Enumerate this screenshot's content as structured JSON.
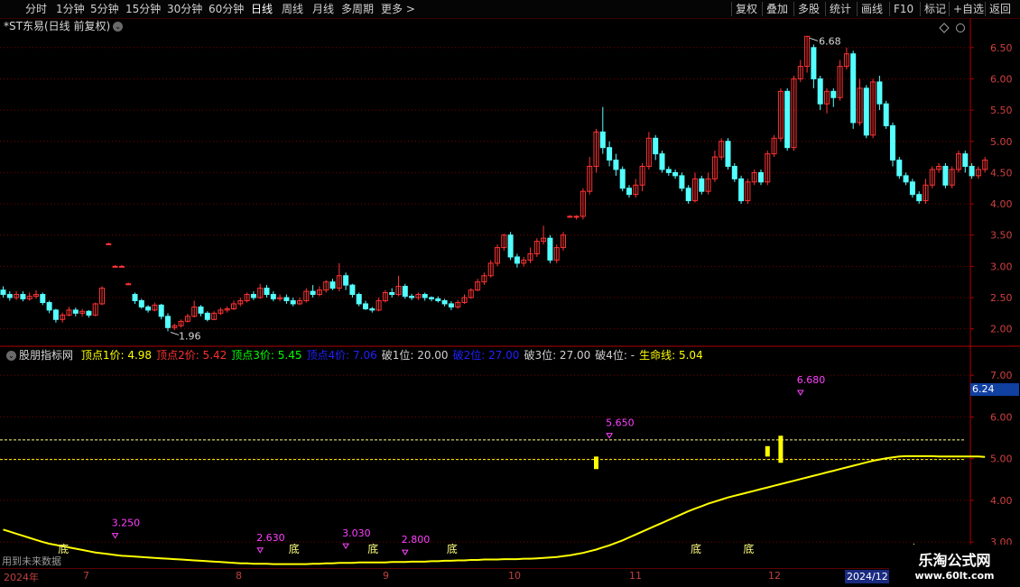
{
  "toolbar": {
    "left": [
      "分时",
      "1分钟",
      "5分钟",
      "15分钟",
      "30分钟",
      "60分钟",
      "日线",
      "周线",
      "月线",
      "多周期",
      "更多 >"
    ],
    "active_index": 6,
    "right": [
      "复权",
      "叠加",
      "多股",
      "统计",
      "画线",
      "F10",
      "标记",
      "+自选",
      "返回"
    ]
  },
  "main_header": {
    "title": "*ST东易(日线 前复权)"
  },
  "indicator_header": {
    "name": "股朋指标网",
    "items": [
      {
        "text": "顶点1价: 4.98",
        "color": "#ffff00"
      },
      {
        "text": "顶点2价: 5.42",
        "color": "#ff3030"
      },
      {
        "text": "顶点3价: 5.45",
        "color": "#00ff00"
      },
      {
        "text": "顶点4价: 7.06",
        "color": "#2020ff"
      },
      {
        "text": "破1位: 20.00",
        "color": "#d0d0d0"
      },
      {
        "text": "破2位: 27.00",
        "color": "#2020ff"
      },
      {
        "text": "破3位: 27.00",
        "color": "#d0d0d0"
      },
      {
        "text": "破4位: -",
        "color": "#d0d0d0"
      },
      {
        "text": "生命线: 5.04",
        "color": "#ffff00"
      }
    ]
  },
  "hint": "用到未来数据",
  "price_tag": "6.24",
  "watermark": {
    "title": "乐淘公式网",
    "url": "www.60lt.com"
  },
  "dates": [
    {
      "label": "2024年"
    },
    {
      "label": "7"
    },
    {
      "label": "8"
    },
    {
      "label": "9"
    },
    {
      "label": "10"
    },
    {
      "label": "11"
    },
    {
      "label": "12"
    },
    {
      "label": "2024/12"
    }
  ],
  "colors": {
    "up": "#ff3333",
    "down": "#54ffff",
    "grid": "#7a0000",
    "axis": "#b00000",
    "life": "#ffff00",
    "top": "#ff40ff",
    "bottom": "#ffff80"
  },
  "chart_data": [
    {
      "type": "candlestick",
      "ylim": [
        1.75,
        6.8
      ],
      "y_ticks": [
        "6.50",
        "6.00",
        "5.50",
        "5.00",
        "4.50",
        "4.00",
        "3.50",
        "3.00",
        "2.50",
        "2.00"
      ],
      "annotations": [
        {
          "text": "6.68",
          "kind": "high"
        },
        {
          "text": "1.96",
          "kind": "low"
        }
      ],
      "candles": [
        [
          2.62,
          2.55,
          2.68,
          2.5
        ],
        [
          2.55,
          2.5,
          2.6,
          2.45
        ],
        [
          2.5,
          2.55,
          2.6,
          2.46
        ],
        [
          2.55,
          2.48,
          2.6,
          2.44
        ],
        [
          2.48,
          2.52,
          2.58,
          2.45
        ],
        [
          2.52,
          2.55,
          2.62,
          2.48
        ],
        [
          2.55,
          2.42,
          2.58,
          2.38
        ],
        [
          2.42,
          2.3,
          2.45,
          2.25
        ],
        [
          2.3,
          2.15,
          2.32,
          2.1
        ],
        [
          2.15,
          2.22,
          2.26,
          2.1
        ],
        [
          2.22,
          2.3,
          2.35,
          2.2
        ],
        [
          2.3,
          2.25,
          2.34,
          2.2
        ],
        [
          2.25,
          2.28,
          2.32,
          2.2
        ],
        [
          2.28,
          2.22,
          2.3,
          2.18
        ],
        [
          2.22,
          2.4,
          2.42,
          2.2
        ],
        [
          2.4,
          2.65,
          2.68,
          2.38
        ],
        [
          3.35,
          3.36,
          3.38,
          3.34
        ],
        [
          3.0,
          3.0,
          3.02,
          2.98
        ],
        [
          3.0,
          3.0,
          3.02,
          2.98
        ],
        [
          2.72,
          2.72,
          2.74,
          2.7
        ],
        [
          2.55,
          2.45,
          2.58,
          2.4
        ],
        [
          2.45,
          2.35,
          2.48,
          2.32
        ],
        [
          2.35,
          2.3,
          2.38,
          2.26
        ],
        [
          2.3,
          2.38,
          2.42,
          2.28
        ],
        [
          2.38,
          2.2,
          2.4,
          2.15
        ],
        [
          2.2,
          2.02,
          2.25,
          1.96
        ],
        [
          2.02,
          2.05,
          2.08,
          1.98
        ],
        [
          2.05,
          2.12,
          2.15,
          2.02
        ],
        [
          2.12,
          2.2,
          2.24,
          2.1
        ],
        [
          2.2,
          2.35,
          2.45,
          2.18
        ],
        [
          2.35,
          2.25,
          2.38,
          2.2
        ],
        [
          2.25,
          2.15,
          2.28,
          2.12
        ],
        [
          2.15,
          2.25,
          2.28,
          2.14
        ],
        [
          2.25,
          2.3,
          2.34,
          2.22
        ],
        [
          2.3,
          2.32,
          2.36,
          2.26
        ],
        [
          2.32,
          2.4,
          2.45,
          2.3
        ],
        [
          2.4,
          2.45,
          2.5,
          2.36
        ],
        [
          2.45,
          2.55,
          2.58,
          2.42
        ],
        [
          2.55,
          2.5,
          2.6,
          2.46
        ],
        [
          2.5,
          2.65,
          2.72,
          2.48
        ],
        [
          2.65,
          2.55,
          2.7,
          2.5
        ],
        [
          2.55,
          2.48,
          2.6,
          2.44
        ],
        [
          2.48,
          2.5,
          2.55,
          2.44
        ],
        [
          2.5,
          2.45,
          2.55,
          2.4
        ],
        [
          2.45,
          2.4,
          2.5,
          2.36
        ],
        [
          2.4,
          2.45,
          2.5,
          2.38
        ],
        [
          2.45,
          2.6,
          2.65,
          2.42
        ],
        [
          2.6,
          2.55,
          2.7,
          2.5
        ],
        [
          2.55,
          2.62,
          2.68,
          2.52
        ],
        [
          2.62,
          2.75,
          2.78,
          2.58
        ],
        [
          2.75,
          2.65,
          2.8,
          2.62
        ],
        [
          2.65,
          2.85,
          3.05,
          2.6
        ],
        [
          2.85,
          2.7,
          2.9,
          2.62
        ],
        [
          2.7,
          2.55,
          2.72,
          2.5
        ],
        [
          2.55,
          2.4,
          2.58,
          2.36
        ],
        [
          2.4,
          2.32,
          2.45,
          2.3
        ],
        [
          2.32,
          2.3,
          2.35,
          2.26
        ],
        [
          2.3,
          2.45,
          2.5,
          2.28
        ],
        [
          2.45,
          2.58,
          2.62,
          2.42
        ],
        [
          2.58,
          2.55,
          2.65,
          2.5
        ],
        [
          2.55,
          2.68,
          2.85,
          2.52
        ],
        [
          2.68,
          2.52,
          2.72,
          2.48
        ],
        [
          2.52,
          2.5,
          2.56,
          2.46
        ],
        [
          2.5,
          2.55,
          2.58,
          2.46
        ],
        [
          2.55,
          2.5,
          2.58,
          2.45
        ],
        [
          2.5,
          2.48,
          2.52,
          2.44
        ],
        [
          2.48,
          2.45,
          2.52,
          2.42
        ],
        [
          2.45,
          2.4,
          2.48,
          2.36
        ],
        [
          2.4,
          2.35,
          2.44,
          2.3
        ],
        [
          2.35,
          2.42,
          2.46,
          2.32
        ],
        [
          2.42,
          2.5,
          2.55,
          2.4
        ],
        [
          2.5,
          2.62,
          2.65,
          2.48
        ],
        [
          2.62,
          2.75,
          2.8,
          2.6
        ],
        [
          2.75,
          2.85,
          2.9,
          2.7
        ],
        [
          2.85,
          3.05,
          3.1,
          2.82
        ],
        [
          3.05,
          3.3,
          3.35,
          3.0
        ],
        [
          3.3,
          3.5,
          3.52,
          3.25
        ],
        [
          3.5,
          3.15,
          3.55,
          3.1
        ],
        [
          3.15,
          3.05,
          3.2,
          2.98
        ],
        [
          3.05,
          3.1,
          3.15,
          3.0
        ],
        [
          3.1,
          3.2,
          3.3,
          3.05
        ],
        [
          3.2,
          3.4,
          3.45,
          3.15
        ],
        [
          3.4,
          3.45,
          3.65,
          3.35
        ],
        [
          3.45,
          3.1,
          3.5,
          3.05
        ],
        [
          3.1,
          3.3,
          3.35,
          3.05
        ],
        [
          3.3,
          3.5,
          3.55,
          3.25
        ],
        [
          3.8,
          3.8,
          3.82,
          3.78
        ],
        [
          3.8,
          3.8,
          3.82,
          3.75
        ],
        [
          3.8,
          4.2,
          4.25,
          3.75
        ],
        [
          4.2,
          4.6,
          4.75,
          4.15
        ],
        [
          4.6,
          5.15,
          5.2,
          4.5
        ],
        [
          5.15,
          4.9,
          5.55,
          4.8
        ],
        [
          4.9,
          4.7,
          5.0,
          4.6
        ],
        [
          4.7,
          4.55,
          4.8,
          4.45
        ],
        [
          4.55,
          4.25,
          4.6,
          4.2
        ],
        [
          4.25,
          4.15,
          4.3,
          4.1
        ],
        [
          4.15,
          4.3,
          4.4,
          4.1
        ],
        [
          4.3,
          4.6,
          4.65,
          4.2
        ],
        [
          4.6,
          5.05,
          5.15,
          4.55
        ],
        [
          5.05,
          4.8,
          5.1,
          4.7
        ],
        [
          4.8,
          4.55,
          4.85,
          4.5
        ],
        [
          4.55,
          4.5,
          4.6,
          4.45
        ],
        [
          4.5,
          4.45,
          4.55,
          4.4
        ],
        [
          4.45,
          4.25,
          4.5,
          4.2
        ],
        [
          4.25,
          4.05,
          4.3,
          4.0
        ],
        [
          4.05,
          4.4,
          4.5,
          4.02
        ],
        [
          4.4,
          4.2,
          4.45,
          4.15
        ],
        [
          4.2,
          4.4,
          4.5,
          4.15
        ],
        [
          4.4,
          4.75,
          4.85,
          4.35
        ],
        [
          4.75,
          5.0,
          5.05,
          4.7
        ],
        [
          5.0,
          4.6,
          5.05,
          4.55
        ],
        [
          4.6,
          4.4,
          4.65,
          4.35
        ],
        [
          4.4,
          4.05,
          4.45,
          4.0
        ],
        [
          4.05,
          4.35,
          4.4,
          4.0
        ],
        [
          4.35,
          4.5,
          4.55,
          4.3
        ],
        [
          4.5,
          4.35,
          4.55,
          4.3
        ],
        [
          4.35,
          4.8,
          4.85,
          4.3
        ],
        [
          4.8,
          5.05,
          5.1,
          4.75
        ],
        [
          5.05,
          5.8,
          5.85,
          5.0
        ],
        [
          5.8,
          4.9,
          5.85,
          4.85
        ],
        [
          4.9,
          6.0,
          6.05,
          4.85
        ],
        [
          6.0,
          6.2,
          6.3,
          5.95
        ],
        [
          6.2,
          6.68,
          6.68,
          6.1
        ],
        [
          6.5,
          6.0,
          6.55,
          5.85
        ],
        [
          6.0,
          5.6,
          6.05,
          5.5
        ],
        [
          5.6,
          5.8,
          5.85,
          5.45
        ],
        [
          5.8,
          5.7,
          5.85,
          5.55
        ],
        [
          5.7,
          6.2,
          6.3,
          5.65
        ],
        [
          6.2,
          6.4,
          6.5,
          6.15
        ],
        [
          6.4,
          5.3,
          6.45,
          5.2
        ],
        [
          5.3,
          5.85,
          6.0,
          5.25
        ],
        [
          5.85,
          5.1,
          5.9,
          5.05
        ],
        [
          5.1,
          5.95,
          6.0,
          5.05
        ],
        [
          5.95,
          5.6,
          6.05,
          5.5
        ],
        [
          5.6,
          5.25,
          5.65,
          5.2
        ],
        [
          5.25,
          4.7,
          5.3,
          4.6
        ],
        [
          4.7,
          4.45,
          4.75,
          4.4
        ],
        [
          4.45,
          4.35,
          4.5,
          4.3
        ],
        [
          4.35,
          4.15,
          4.4,
          4.1
        ],
        [
          4.15,
          4.05,
          4.2,
          4.0
        ],
        [
          4.05,
          4.3,
          4.4,
          4.0
        ],
        [
          4.3,
          4.55,
          4.6,
          4.25
        ],
        [
          4.55,
          4.6,
          4.65,
          4.5
        ],
        [
          4.6,
          4.3,
          4.65,
          4.25
        ],
        [
          4.3,
          4.55,
          4.6,
          4.25
        ],
        [
          4.55,
          4.8,
          4.85,
          4.5
        ],
        [
          4.8,
          4.6,
          4.85,
          4.5
        ],
        [
          4.6,
          4.45,
          4.65,
          4.4
        ],
        [
          4.45,
          4.55,
          4.6,
          4.4
        ],
        [
          4.55,
          4.7,
          4.75,
          4.5
        ]
      ]
    },
    {
      "type": "line",
      "name": "生命线",
      "ylim": [
        2.7,
        7.35
      ],
      "y_ticks": [
        "7.00",
        "6.00",
        "5.00",
        "4.00",
        "3.00"
      ],
      "reference_lines": [
        {
          "value": 5.45,
          "color": "#ffff80"
        },
        {
          "value": 4.98,
          "color": "#ffff00"
        }
      ],
      "values": [
        3.3,
        3.25,
        3.2,
        3.15,
        3.1,
        3.05,
        3.0,
        2.96,
        2.93,
        2.9,
        2.87,
        2.84,
        2.81,
        2.78,
        2.75,
        2.73,
        2.71,
        2.69,
        2.67,
        2.66,
        2.65,
        2.64,
        2.63,
        2.62,
        2.61,
        2.6,
        2.59,
        2.58,
        2.57,
        2.56,
        2.55,
        2.54,
        2.53,
        2.52,
        2.51,
        2.5,
        2.49,
        2.49,
        2.48,
        2.48,
        2.48,
        2.47,
        2.47,
        2.47,
        2.47,
        2.47,
        2.47,
        2.48,
        2.48,
        2.49,
        2.49,
        2.5,
        2.5,
        2.5,
        2.51,
        2.51,
        2.51,
        2.51,
        2.51,
        2.52,
        2.52,
        2.52,
        2.53,
        2.53,
        2.53,
        2.54,
        2.54,
        2.55,
        2.55,
        2.56,
        2.56,
        2.57,
        2.57,
        2.58,
        2.58,
        2.58,
        2.59,
        2.59,
        2.59,
        2.6,
        2.6,
        2.61,
        2.62,
        2.63,
        2.64,
        2.66,
        2.68,
        2.71,
        2.74,
        2.78,
        2.82,
        2.87,
        2.92,
        2.98,
        3.04,
        3.11,
        3.18,
        3.25,
        3.32,
        3.39,
        3.46,
        3.53,
        3.6,
        3.67,
        3.74,
        3.8,
        3.86,
        3.92,
        3.97,
        4.02,
        4.07,
        4.11,
        4.15,
        4.19,
        4.23,
        4.27,
        4.31,
        4.35,
        4.39,
        4.43,
        4.47,
        4.51,
        4.55,
        4.59,
        4.63,
        4.67,
        4.71,
        4.75,
        4.79,
        4.83,
        4.87,
        4.91,
        4.95,
        4.98,
        5.01,
        5.03,
        5.05,
        5.06,
        5.06,
        5.06,
        5.06,
        5.06,
        5.05,
        5.05,
        5.05,
        5.05,
        5.05,
        5.05,
        5.05,
        5.04
      ],
      "signals": [
        {
          "kind": "top",
          "label": "3.250",
          "value": 3.25
        },
        {
          "kind": "top",
          "label": "2.630",
          "value": 2.9
        },
        {
          "kind": "top",
          "label": "3.030",
          "value": 3.0
        },
        {
          "kind": "top",
          "label": "2.800",
          "value": 2.85
        },
        {
          "kind": "top",
          "label": "5.650",
          "value": 5.65
        },
        {
          "kind": "top",
          "label": "6.680",
          "value": 6.68
        },
        {
          "kind": "bottom",
          "label": "底"
        },
        {
          "kind": "bottom",
          "label": "底"
        },
        {
          "kind": "bottom",
          "label": "底"
        },
        {
          "kind": "bottom",
          "label": "底"
        },
        {
          "kind": "bottom",
          "label": "底"
        },
        {
          "kind": "bottom",
          "label": "底"
        },
        {
          "kind": "bottom",
          "label": "底"
        }
      ],
      "bars": [
        {
          "from": 4.75,
          "to": 5.05
        },
        {
          "from": 5.05,
          "to": 5.3
        },
        {
          "from": 4.9,
          "to": 5.55
        }
      ]
    }
  ]
}
